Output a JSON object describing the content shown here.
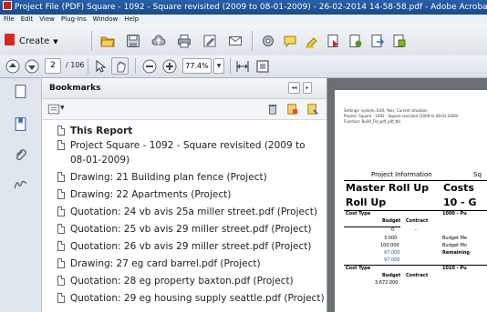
{
  "window": {
    "title": "Project File (PDF) Square - 1092 - Square revisited (2009 to 08-01-2009) - 26-02-2014 14-58-58.pdf - Adobe Acrobat Pro"
  },
  "menu": [
    "File",
    "Edit",
    "View",
    "Plug-Ins",
    "Window",
    "Help"
  ],
  "toolbar": {
    "create_label": "Create",
    "page_current": "2",
    "page_total": "/ 106",
    "zoom_value": "77.4%"
  },
  "bookmarks_panel": {
    "title": "Bookmarks",
    "items": [
      {
        "label": "This Report",
        "bold": true
      },
      {
        "label": "Project Square - 1092 - Square revisited (2009 to",
        "label2": "08-01-2009)"
      },
      {
        "label": "Drawing: 21 Building plan fence (Project)"
      },
      {
        "label": "Drawing: 22 Apartments (Project)"
      },
      {
        "label": "Quotation: 24 vb avis 25a miller street.pdf (Project)"
      },
      {
        "label": "Quotation: 25 vb avis 29 miller street.pdf (Project)"
      },
      {
        "label": "Quotation: 26 vb avis 29 miller street.pdf (Project)"
      },
      {
        "label": "Drawing: 27 eg card barrel.pdf (Project)"
      },
      {
        "label": "Quotation: 28 eg property baxton.pdf (Project)"
      },
      {
        "label": "Quotation: 29 eg housing supply seattle.pdf (Project)"
      }
    ]
  },
  "document": {
    "settings_line1": "Settings: system, EUR, Year, Current situation",
    "settings_line2": "Project: Square - 1092 - Square revisited (2009 to 08-01-2009)",
    "settings_line3": "Function: Build_Fld_pdf_pdf_tbl",
    "project_info": "Project Information",
    "sq": "Sq",
    "master_roll_up": "Master Roll Up",
    "roll_up": "Roll Up",
    "costs": "Costs",
    "ten_g": "10 - G",
    "cost_type": "Cost Type",
    "budget": "Budget",
    "contract": "Contract",
    "code_1000": "1000 - Pu",
    "code_1010": "1010 - Pu",
    "rows": [
      "0",
      "-",
      "3.000",
      "100.000",
      "97.000",
      "97.000"
    ],
    "row_labels": [
      "Budget Me",
      "Budget Mo",
      "Remaining"
    ],
    "bottom_value": "3.672.000"
  }
}
